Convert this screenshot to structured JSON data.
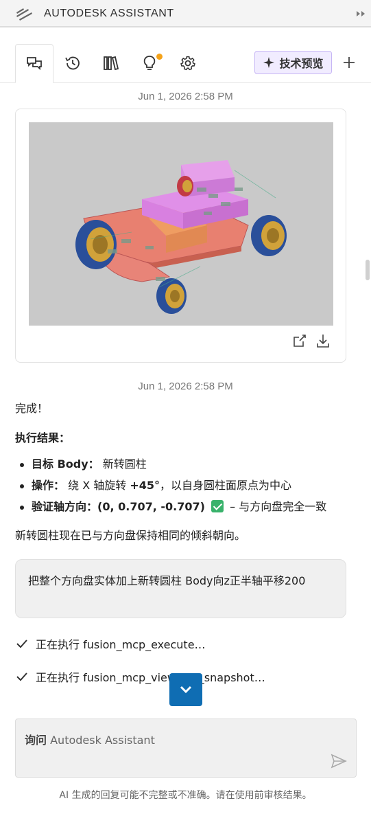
{
  "window": {
    "title": "AUTODESK ASSISTANT"
  },
  "tabs": [
    {
      "name": "chat",
      "icon": "chat-bubbles-icon"
    },
    {
      "name": "history",
      "icon": "history-clock-icon"
    },
    {
      "name": "library",
      "icon": "library-books-icon"
    },
    {
      "name": "tips",
      "icon": "lightbulb-icon",
      "notification_color": "#f5a31a"
    },
    {
      "name": "settings",
      "icon": "gear-icon"
    }
  ],
  "toolbar": {
    "preview_label": "技术预览",
    "preview_icon": "sparkle-icon",
    "add_icon": "plus-icon"
  },
  "conversation": {
    "timestamp_1": "Jun 1, 2026 2:58 PM",
    "timestamp_2": "Jun 1, 2026 2:58 PM",
    "done": "完成！",
    "results_heading": "执行结果：",
    "results": [
      {
        "label": "目标 Body：",
        "text": "新转圆柱"
      },
      {
        "label": "操作：",
        "text_pre": "绕 X 轴旋转 ",
        "text_bold": "+45°",
        "text_post": "，以自身圆柱面原点为中心"
      },
      {
        "label": "验证轴方向：",
        "value": "(0, 0.707, -0.707)",
        "suffix": " – 与方向盘完全一致"
      }
    ],
    "summary": "新转圆柱现在已与方向盘保持相同的倾斜朝向。",
    "user_message": "把整个方向盘实体加上新转圆柱 Body向z正半轴平移200",
    "steps": [
      {
        "text": "正在执行 fusion_mcp_execute…"
      },
      {
        "text_visible": "正在执行 fusion_mcp_vi",
        "text_hidden_tail": "ewport_snapshot…"
      }
    ]
  },
  "input": {
    "placeholder_bold": "询问",
    "placeholder": "Autodesk Assistant"
  },
  "disclaimer": "AI 生成的回复可能不完整或不准确。请在使用前审核结果。",
  "colors": {
    "accent": "#0f6db3",
    "preview_bg": "#f1ecff",
    "preview_border": "#c7b7f5",
    "check": "#38b26b"
  }
}
